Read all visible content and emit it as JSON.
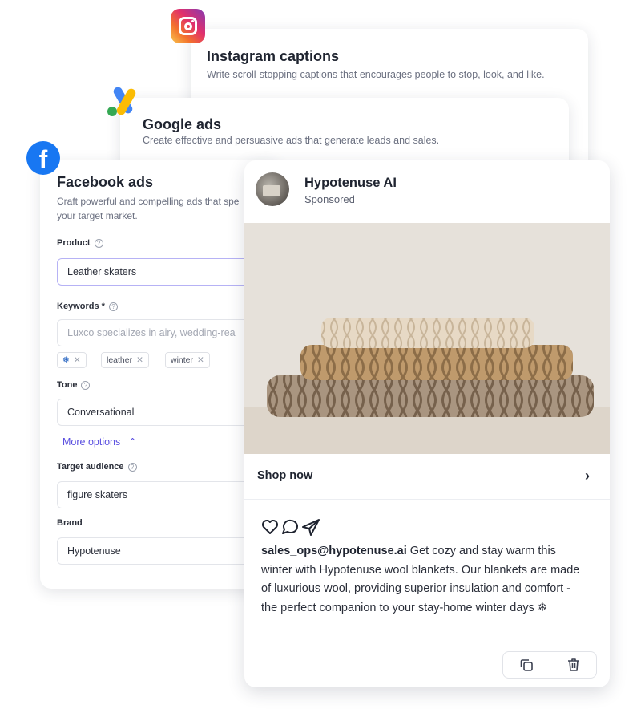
{
  "instagram_card": {
    "title": "Instagram captions",
    "description": "Write scroll-stopping captions that encourages people to stop, look, and like."
  },
  "google_card": {
    "title": "Google ads",
    "description": "Create effective and persuasive ads that generate leads and sales."
  },
  "facebook_form": {
    "title": "Facebook ads",
    "description_line1": "Craft powerful and compelling ads that spe",
    "description_line2": "your target market.",
    "product": {
      "label": "Product",
      "value": "Leather skaters"
    },
    "keywords": {
      "label": "Keywords *",
      "placeholder": "Luxco specializes in airy, wedding-rea",
      "chips": [
        "leather",
        "winter"
      ]
    },
    "tone": {
      "label": "Tone",
      "value": "Conversational"
    },
    "more_options": "More options",
    "target_audience": {
      "label": "Target audience",
      "value": "figure skaters"
    },
    "brand": {
      "label": "Brand",
      "value": "Hypotenuse"
    }
  },
  "post_preview": {
    "page_name": "Hypotenuse AI",
    "sponsored": "Sponsored",
    "cta": "Shop now",
    "handle": "sales_ops@hypotenuse.ai",
    "body": " Get cozy and stay warm this winter with Hypotenuse wool blankets. Our blankets are made of luxurious wool, providing superior insulation and comfort - the perfect companion to your stay-home winter days ❄"
  },
  "colors": {
    "accent": "#5a4fe0",
    "facebook": "#1877f2",
    "google_blue": "#4285f4",
    "google_yellow": "#fbbc04",
    "google_green": "#34a853"
  },
  "icons": [
    "instagram-logo",
    "google-ads-logo",
    "facebook-logo",
    "help-icon",
    "chip-remove-icon",
    "chevron-up-icon",
    "chevron-right-icon",
    "heart-icon",
    "comment-icon",
    "share-icon",
    "copy-icon",
    "trash-icon"
  ]
}
